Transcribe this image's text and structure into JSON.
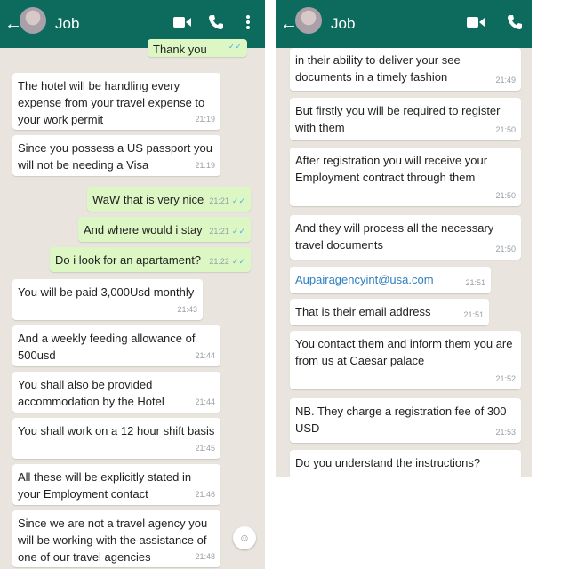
{
  "contact_name": "Job",
  "left": {
    "messages": [
      {
        "dir": "out",
        "text": "Thank you",
        "time": "",
        "ticks": "✓✓"
      },
      {
        "dir": "in",
        "text": "The hotel will be handling every expense from your travel expense to your work permit",
        "time": "21:19"
      },
      {
        "dir": "in",
        "text": "Since you possess a US passport you will not be needing a Visa",
        "time": "21:19"
      },
      {
        "dir": "out",
        "text": "WaW that is very nice",
        "time": "21:21",
        "ticks": "✓✓"
      },
      {
        "dir": "out",
        "text": "And where would i stay",
        "time": "21:21",
        "ticks": "✓✓"
      },
      {
        "dir": "out",
        "text": "Do i look for an apartament?",
        "time": "21:22",
        "ticks": "✓✓"
      },
      {
        "dir": "in",
        "text": "You will be paid 3,000Usd monthly",
        "time": "21:43"
      },
      {
        "dir": "in",
        "text": "And a weekly feeding allowance of 500usd",
        "time": "21:44"
      },
      {
        "dir": "in",
        "text": "You shall also be provided accommodation by the Hotel",
        "time": "21:44"
      },
      {
        "dir": "in",
        "text": "You shall work on a 12 hour shift basis",
        "time": "21:45"
      },
      {
        "dir": "in",
        "text": "All these will be explicitly stated in your Employment contact",
        "time": "21:46"
      },
      {
        "dir": "in",
        "text": "Since we are not a travel agency you will be working with the assistance of one of our travel agencies",
        "time": "21:48"
      }
    ]
  },
  "right": {
    "messages": [
      {
        "dir": "in",
        "text": "in their ability to deliver your see documents in a timely fashion",
        "time": "21:49"
      },
      {
        "dir": "in",
        "text": "But firstly you will be required to register with them",
        "time": "21:50"
      },
      {
        "dir": "in",
        "text": "After registration you will receive your Employment contract through them",
        "time": "21:50"
      },
      {
        "dir": "in",
        "text": "And they will process all the necessary travel documents",
        "time": "21:50"
      },
      {
        "dir": "in",
        "text": "Aupairagencyint@usa.com",
        "time": "21:51",
        "link": true
      },
      {
        "dir": "in",
        "text": "That is their email address",
        "time": "21:51"
      },
      {
        "dir": "in",
        "text": "You contact them and inform them you are from us at Caesar palace",
        "time": "21:52"
      },
      {
        "dir": "in",
        "text": "NB. They charge a registration fee of 300 USD",
        "time": "21:53"
      },
      {
        "dir": "in",
        "text": "Do you understand the instructions?",
        "time": ""
      }
    ]
  },
  "icons": {
    "back": "arrow-left-icon",
    "video": "video-camera-icon",
    "call": "phone-icon",
    "menu": "more-vertical-icon",
    "emoji": "emoji-icon"
  },
  "colors": {
    "header": "#0d6b5e",
    "incoming_bubble": "#ffffff",
    "outgoing_bubble": "#dcf6c4",
    "chat_background": "#e9e4de",
    "link": "#2d7fbf",
    "read_ticks": "#4fb3e0"
  }
}
